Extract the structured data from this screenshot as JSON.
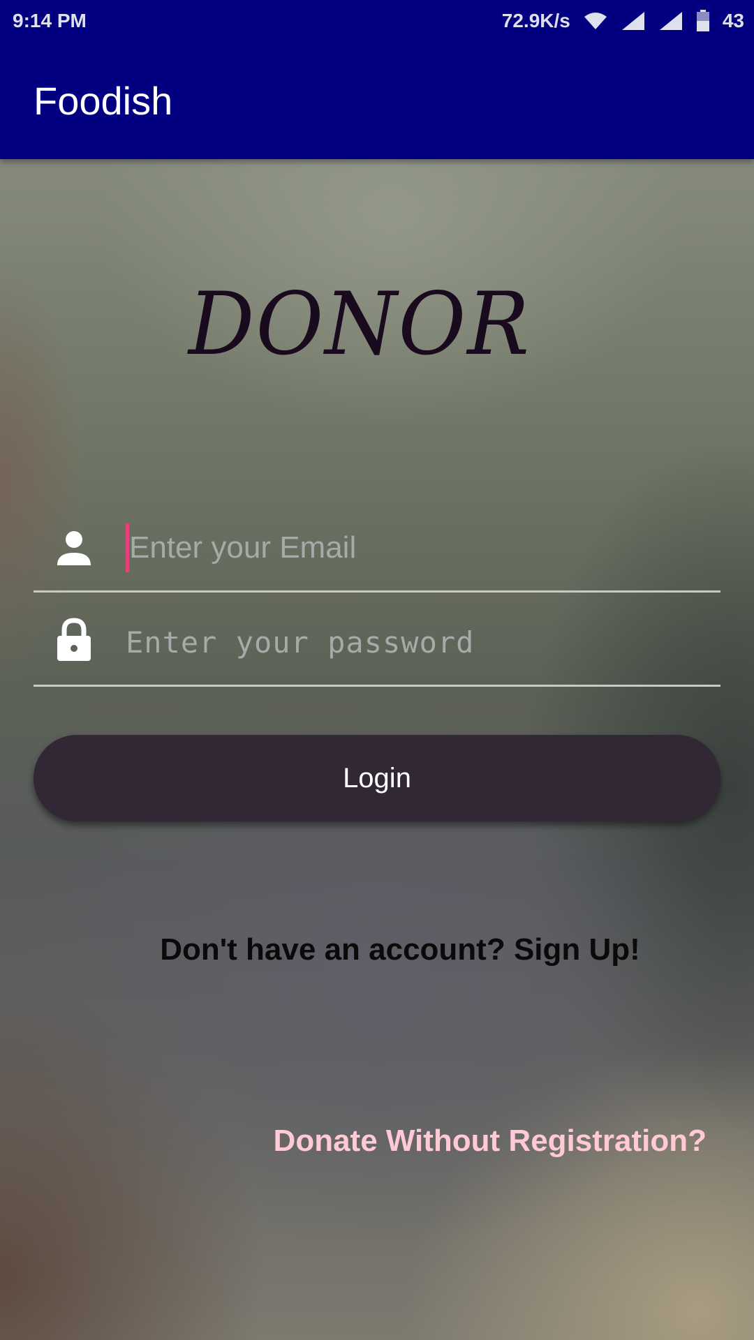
{
  "status_bar": {
    "time": "9:14 PM",
    "network_speed": "72.9K/s",
    "battery": "43",
    "icons": [
      "wifi-icon",
      "signal-icon",
      "signal-icon",
      "battery-icon"
    ]
  },
  "app_bar": {
    "title": "Foodish",
    "color": "#020080"
  },
  "heading": "DONOR",
  "form": {
    "email": {
      "placeholder": "Enter your Email",
      "value": "",
      "icon": "person-icon"
    },
    "password": {
      "placeholder": "Enter your password",
      "value": "",
      "icon": "lock-icon"
    },
    "login_label": "Login",
    "login_color": "#312735"
  },
  "links": {
    "signup": "Don't have an account? Sign Up!",
    "donate_without_registration": "Donate Without Registration?",
    "donate_color": "#ffc9d6"
  },
  "colors": {
    "cursor": "#e8407a"
  }
}
